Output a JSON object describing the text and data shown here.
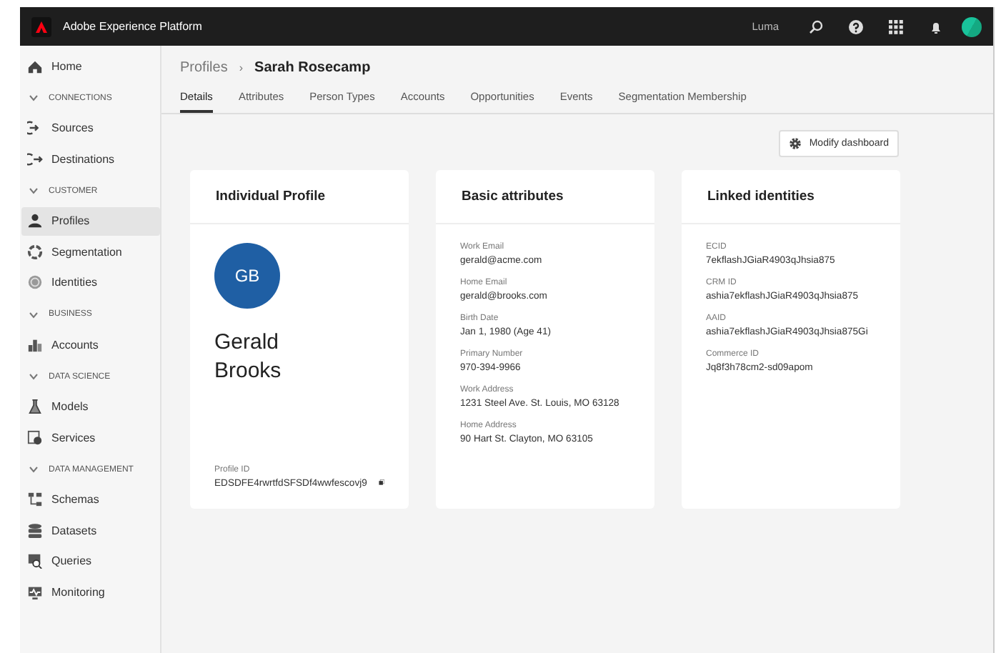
{
  "header": {
    "title": "Adobe Experience Platform",
    "org": "Luma"
  },
  "sidebar": [
    {
      "kind": "item",
      "label": "Home",
      "selected": false
    },
    {
      "kind": "section",
      "label": "CONNECTIONS"
    },
    {
      "kind": "item",
      "label": "Sources",
      "selected": false
    },
    {
      "kind": "item",
      "label": "Destinations",
      "selected": false
    },
    {
      "kind": "section",
      "label": "CUSTOMER"
    },
    {
      "kind": "item",
      "label": "Profiles",
      "selected": true
    },
    {
      "kind": "item",
      "label": "Segmentation",
      "selected": false
    },
    {
      "kind": "item",
      "label": "Identities",
      "selected": false
    },
    {
      "kind": "section",
      "label": "BUSINESS"
    },
    {
      "kind": "item",
      "label": "Accounts",
      "selected": false
    },
    {
      "kind": "section",
      "label": "DATA SCIENCE"
    },
    {
      "kind": "item",
      "label": "Models",
      "selected": false
    },
    {
      "kind": "item",
      "label": "Services",
      "selected": false
    },
    {
      "kind": "section",
      "label": "DATA MANAGEMENT"
    },
    {
      "kind": "item",
      "label": "Schemas",
      "selected": false
    },
    {
      "kind": "item",
      "label": "Datasets",
      "selected": false
    },
    {
      "kind": "item",
      "label": "Queries",
      "selected": false
    },
    {
      "kind": "item",
      "label": "Monitoring",
      "selected": false
    }
  ],
  "breadcrumb": {
    "parent": "Profiles",
    "separator": "›",
    "current": "Sarah Rosecamp"
  },
  "tabs": [
    {
      "label": "Details",
      "selected": true
    },
    {
      "label": "Attributes",
      "selected": false
    },
    {
      "label": "Person Types",
      "selected": false
    },
    {
      "label": "Accounts",
      "selected": false
    },
    {
      "label": "Opportunities",
      "selected": false
    },
    {
      "label": "Events",
      "selected": false
    },
    {
      "label": "Segmentation Membership",
      "selected": false
    }
  ],
  "modify_button": "Modify dashboard",
  "profile_card": {
    "title": "Individual Profile",
    "initials": "GB",
    "first_name": "Gerald",
    "last_name": "Brooks",
    "id_label": "Profile ID",
    "id_value": "EDSDFE4rwrtfdSFSDf4wwfescovj9"
  },
  "attribute_cards": [
    {
      "title": "Basic attributes",
      "fields": [
        {
          "label": "Work Email",
          "value": "gerald@acme.com"
        },
        {
          "label": "Home Email",
          "value": "gerald@brooks.com"
        },
        {
          "label": "Birth Date",
          "value": "Jan 1, 1980 (Age 41)"
        },
        {
          "label": "Primary Number",
          "value": "970-394-9966"
        },
        {
          "label": "Work Address",
          "value": "1231 Steel Ave. St. Louis, MO 63128"
        },
        {
          "label": "Home Address",
          "value": "90 Hart St. Clayton, MO 63105"
        }
      ]
    },
    {
      "title": "Linked identities",
      "fields": [
        {
          "label": "ECID",
          "value": "7ekflashJGiaR4903qJhsia875"
        },
        {
          "label": "CRM ID",
          "value": "ashia7ekflashJGiaR4903qJhsia875"
        },
        {
          "label": "AAID",
          "value": "ashia7ekflashJGiaR4903qJhsia875Gi"
        },
        {
          "label": "Commerce ID",
          "value": "Jq8f3h78cm2-sd09apom"
        }
      ]
    }
  ]
}
